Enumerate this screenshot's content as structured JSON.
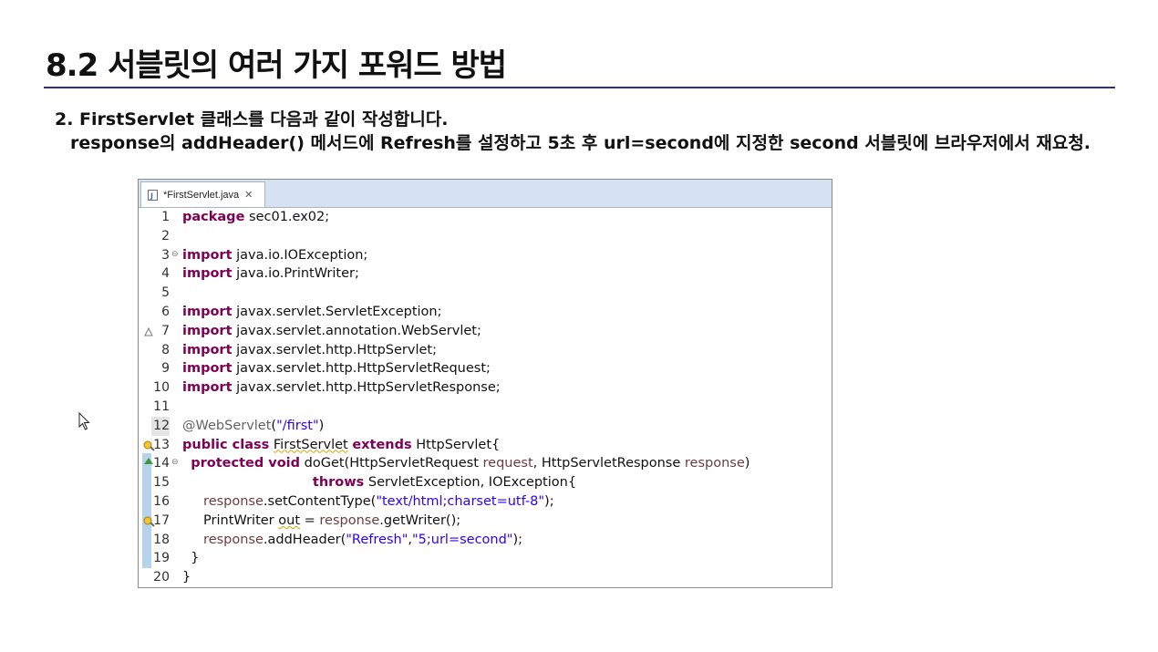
{
  "slide": {
    "title": "8.2 서블릿의 여러 가지 포워드 방법",
    "description_line1": "2. FirstServlet 클래스를 다음과 같이 작성합니다.",
    "description_line2": "response의 addHeader() 메서드에 Refresh를 설정하고 5초 후 url=second에 지정한 second 서블릿에 브라우저에서 재요청."
  },
  "editor": {
    "tab_label": "*FirstServlet.java",
    "tab_close_symbol": "✕",
    "current_line": 12,
    "lines": [
      {
        "num": "1",
        "marker": "",
        "fold": "",
        "tokens": [
          {
            "t": "package",
            "c": "kw"
          },
          {
            "t": " sec01.ex02;",
            "c": ""
          }
        ]
      },
      {
        "num": "2",
        "marker": "",
        "fold": "",
        "tokens": []
      },
      {
        "num": "3",
        "marker": "",
        "fold": "⊖",
        "tokens": [
          {
            "t": "import",
            "c": "kw"
          },
          {
            "t": " java.io.IOException;",
            "c": ""
          }
        ]
      },
      {
        "num": "4",
        "marker": "",
        "fold": "",
        "tokens": [
          {
            "t": "import",
            "c": "kw"
          },
          {
            "t": " java.io.PrintWriter;",
            "c": ""
          }
        ]
      },
      {
        "num": "5",
        "marker": "",
        "fold": "",
        "tokens": []
      },
      {
        "num": "6",
        "marker": "",
        "fold": "",
        "tokens": [
          {
            "t": "import",
            "c": "kw"
          },
          {
            "t": " javax.servlet.ServletException;",
            "c": ""
          }
        ]
      },
      {
        "num": "7",
        "marker": "warning",
        "fold": "",
        "tokens": [
          {
            "t": "import",
            "c": "kw"
          },
          {
            "t": " javax.servlet.annotation.WebServlet;",
            "c": ""
          }
        ]
      },
      {
        "num": "8",
        "marker": "",
        "fold": "",
        "tokens": [
          {
            "t": "import",
            "c": "kw"
          },
          {
            "t": " javax.servlet.http.HttpServlet;",
            "c": ""
          }
        ]
      },
      {
        "num": "9",
        "marker": "",
        "fold": "",
        "tokens": [
          {
            "t": "import",
            "c": "kw"
          },
          {
            "t": " javax.servlet.http.HttpServletRequest;",
            "c": ""
          }
        ]
      },
      {
        "num": "10",
        "marker": "",
        "fold": "",
        "tokens": [
          {
            "t": "import",
            "c": "kw"
          },
          {
            "t": " javax.servlet.http.HttpServletResponse;",
            "c": ""
          }
        ]
      },
      {
        "num": "11",
        "marker": "",
        "fold": "",
        "tokens": []
      },
      {
        "num": "12",
        "marker": "",
        "fold": "",
        "tokens": [
          {
            "t": "@WebServlet",
            "c": "ann"
          },
          {
            "t": "(",
            "c": ""
          },
          {
            "t": "\"/first\"",
            "c": "str"
          },
          {
            "t": ")",
            "c": ""
          }
        ]
      },
      {
        "num": "13",
        "marker": "quickfix",
        "fold": "",
        "tokens": [
          {
            "t": "public class",
            "c": "kw"
          },
          {
            "t": " ",
            "c": ""
          },
          {
            "t": "FirstServlet",
            "c": "warnu"
          },
          {
            "t": " ",
            "c": ""
          },
          {
            "t": "extends",
            "c": "kw"
          },
          {
            "t": " HttpServlet{",
            "c": ""
          }
        ]
      },
      {
        "num": "14",
        "marker": "override",
        "fold": "⊖",
        "tokens": [
          {
            "t": "  ",
            "c": ""
          },
          {
            "t": "protected void",
            "c": "kw"
          },
          {
            "t": " doGet(HttpServletRequest ",
            "c": ""
          },
          {
            "t": "request",
            "c": "param"
          },
          {
            "t": ", HttpServletResponse ",
            "c": ""
          },
          {
            "t": "response",
            "c": "param"
          },
          {
            "t": ")",
            "c": ""
          }
        ]
      },
      {
        "num": "15",
        "marker": "",
        "fold": "",
        "tokens": [
          {
            "t": "                               ",
            "c": ""
          },
          {
            "t": "throws",
            "c": "kw"
          },
          {
            "t": " ServletException, IOException{",
            "c": ""
          }
        ]
      },
      {
        "num": "16",
        "marker": "",
        "fold": "",
        "tokens": [
          {
            "t": "     ",
            "c": ""
          },
          {
            "t": "response",
            "c": "param"
          },
          {
            "t": ".setContentType(",
            "c": ""
          },
          {
            "t": "\"text/html;charset=utf-8\"",
            "c": "str"
          },
          {
            "t": ");",
            "c": ""
          }
        ]
      },
      {
        "num": "17",
        "marker": "quickfix",
        "fold": "",
        "tokens": [
          {
            "t": "     PrintWriter ",
            "c": ""
          },
          {
            "t": "out",
            "c": "warnu"
          },
          {
            "t": " = ",
            "c": ""
          },
          {
            "t": "response",
            "c": "param"
          },
          {
            "t": ".getWriter();",
            "c": ""
          }
        ]
      },
      {
        "num": "18",
        "marker": "",
        "fold": "",
        "tokens": [
          {
            "t": "     ",
            "c": ""
          },
          {
            "t": "response",
            "c": "param"
          },
          {
            "t": ".addHeader(",
            "c": ""
          },
          {
            "t": "\"Refresh\"",
            "c": "str"
          },
          {
            "t": ",",
            "c": ""
          },
          {
            "t": "\"5;url=second\"",
            "c": "str"
          },
          {
            "t": ");",
            "c": ""
          }
        ]
      },
      {
        "num": "19",
        "marker": "",
        "fold": "",
        "tokens": [
          {
            "t": "  }",
            "c": ""
          }
        ]
      },
      {
        "num": "20",
        "marker": "",
        "fold": "",
        "tokens": [
          {
            "t": "}",
            "c": ""
          }
        ]
      }
    ]
  },
  "colors": {
    "keyword": "#7f0055",
    "string": "#2a00ff",
    "annotation": "#646464",
    "parameter": "#6a3e3e",
    "title_rule": "#2b2f8a",
    "tab_bar": "#d5e2f2"
  }
}
